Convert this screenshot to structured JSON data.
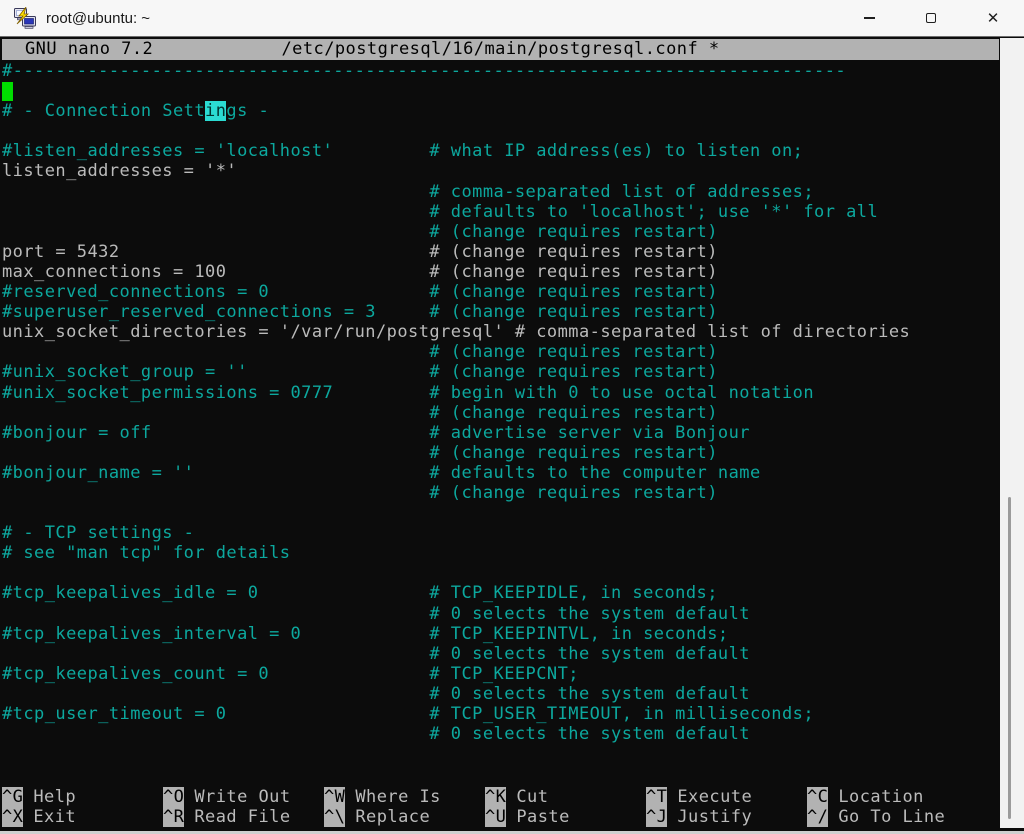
{
  "window": {
    "title": "root@ubuntu: ~",
    "close_glyph": "✕"
  },
  "nano": {
    "version_label": "GNU nano 7.2",
    "file_label": "/etc/postgresql/16/main/postgresql.conf *"
  },
  "colors": {
    "terminal_bg": "#0C0C0C",
    "text": "#BBBBBB",
    "comment": "#0CA89E",
    "cursor": "#00DD00",
    "match_bg": "#2BDBD2",
    "match_text": "#00332F",
    "bar_bg": "#B2B2B2",
    "bar_text": "#000000",
    "titlebar_bg": "#F7F7F7",
    "titlebar_text": "#191919",
    "scroll_track": "#F2F2F2",
    "scroll_thumb": "#9B9B9B"
  },
  "editor": {
    "lines": [
      {
        "type": "separator",
        "prefix": "#",
        "char": "-",
        "count": 78,
        "color": "comment"
      },
      {
        "type": "cursor"
      },
      {
        "type": "match",
        "pre": "# - Connection Sett",
        "match": "in",
        "post": "gs -",
        "color": "comment"
      },
      {
        "type": "blank"
      },
      {
        "type": "text",
        "color": "comment",
        "code": "#listen_addresses = 'localhost'",
        "comment": "# what IP address(es) to listen on;",
        "col": 40
      },
      {
        "type": "text",
        "color": "code",
        "code": "listen_addresses = '*'"
      },
      {
        "type": "text",
        "color": "comment",
        "code": "",
        "comment": "# comma-separated list of addresses;",
        "col": 40
      },
      {
        "type": "text",
        "color": "comment",
        "code": "",
        "comment": "# defaults to 'localhost'; use '*' for all",
        "col": 40
      },
      {
        "type": "text",
        "color": "comment",
        "code": "",
        "comment": "# (change requires restart)",
        "col": 40
      },
      {
        "type": "text",
        "color": "code",
        "code": "port = 5432",
        "comment": "# (change requires restart)",
        "col": 40
      },
      {
        "type": "text",
        "color": "code",
        "code": "max_connections = 100",
        "comment": "# (change requires restart)",
        "col": 40
      },
      {
        "type": "text",
        "color": "comment",
        "code": "#reserved_connections = 0",
        "comment": "# (change requires restart)",
        "col": 40
      },
      {
        "type": "text",
        "color": "comment",
        "code": "#superuser_reserved_connections = 3",
        "comment": "# (change requires restart)",
        "col": 40
      },
      {
        "type": "text",
        "color": "code",
        "code": "unix_socket_directories = '/var/run/postgresql'",
        "comment": "# comma-separated list of directories"
      },
      {
        "type": "text",
        "color": "comment",
        "code": "",
        "comment": "# (change requires restart)",
        "col": 40
      },
      {
        "type": "text",
        "color": "comment",
        "code": "#unix_socket_group = ''",
        "comment": "# (change requires restart)",
        "col": 40
      },
      {
        "type": "text",
        "color": "comment",
        "code": "#unix_socket_permissions = 0777",
        "comment": "# begin with 0 to use octal notation",
        "col": 40
      },
      {
        "type": "text",
        "color": "comment",
        "code": "",
        "comment": "# (change requires restart)",
        "col": 40
      },
      {
        "type": "text",
        "color": "comment",
        "code": "#bonjour = off",
        "comment": "# advertise server via Bonjour",
        "col": 40
      },
      {
        "type": "text",
        "color": "comment",
        "code": "",
        "comment": "# (change requires restart)",
        "col": 40
      },
      {
        "type": "text",
        "color": "comment",
        "code": "#bonjour_name = ''",
        "comment": "# defaults to the computer name",
        "col": 40
      },
      {
        "type": "text",
        "color": "comment",
        "code": "",
        "comment": "# (change requires restart)",
        "col": 40
      },
      {
        "type": "blank"
      },
      {
        "type": "text",
        "color": "comment",
        "code": "# - TCP settings -"
      },
      {
        "type": "text",
        "color": "comment",
        "code": "# see \"man tcp\" for details"
      },
      {
        "type": "blank"
      },
      {
        "type": "text",
        "color": "comment",
        "code": "#tcp_keepalives_idle = 0",
        "comment": "# TCP_KEEPIDLE, in seconds;",
        "col": 40
      },
      {
        "type": "text",
        "color": "comment",
        "code": "",
        "comment": "# 0 selects the system default",
        "col": 40
      },
      {
        "type": "text",
        "color": "comment",
        "code": "#tcp_keepalives_interval = 0",
        "comment": "# TCP_KEEPINTVL, in seconds;",
        "col": 40
      },
      {
        "type": "text",
        "color": "comment",
        "code": "",
        "comment": "# 0 selects the system default",
        "col": 40
      },
      {
        "type": "text",
        "color": "comment",
        "code": "#tcp_keepalives_count = 0",
        "comment": "# TCP_KEEPCNT;",
        "col": 40
      },
      {
        "type": "text",
        "color": "comment",
        "code": "",
        "comment": "# 0 selects the system default",
        "col": 40
      },
      {
        "type": "text",
        "color": "comment",
        "code": "#tcp_user_timeout = 0",
        "comment": "# TCP_USER_TIMEOUT, in milliseconds;",
        "col": 40
      },
      {
        "type": "text",
        "color": "comment",
        "code": "",
        "comment": "# 0 selects the system default",
        "col": 40
      }
    ]
  },
  "shortcuts": [
    {
      "items": [
        {
          "key": "^G",
          "label": "Help"
        },
        {
          "key": "^X",
          "label": "Exit"
        }
      ]
    },
    {
      "items": [
        {
          "key": "^O",
          "label": "Write Out"
        },
        {
          "key": "^R",
          "label": "Read File"
        }
      ]
    },
    {
      "items": [
        {
          "key": "^W",
          "label": "Where Is"
        },
        {
          "key": "^\\",
          "label": "Replace"
        }
      ]
    },
    {
      "items": [
        {
          "key": "^K",
          "label": "Cut"
        },
        {
          "key": "^U",
          "label": "Paste"
        }
      ]
    },
    {
      "items": [
        {
          "key": "^T",
          "label": "Execute"
        },
        {
          "key": "^J",
          "label": "Justify"
        }
      ]
    },
    {
      "items": [
        {
          "key": "^C",
          "label": "Location"
        },
        {
          "key": "^/",
          "label": "Go To Line"
        }
      ]
    }
  ]
}
